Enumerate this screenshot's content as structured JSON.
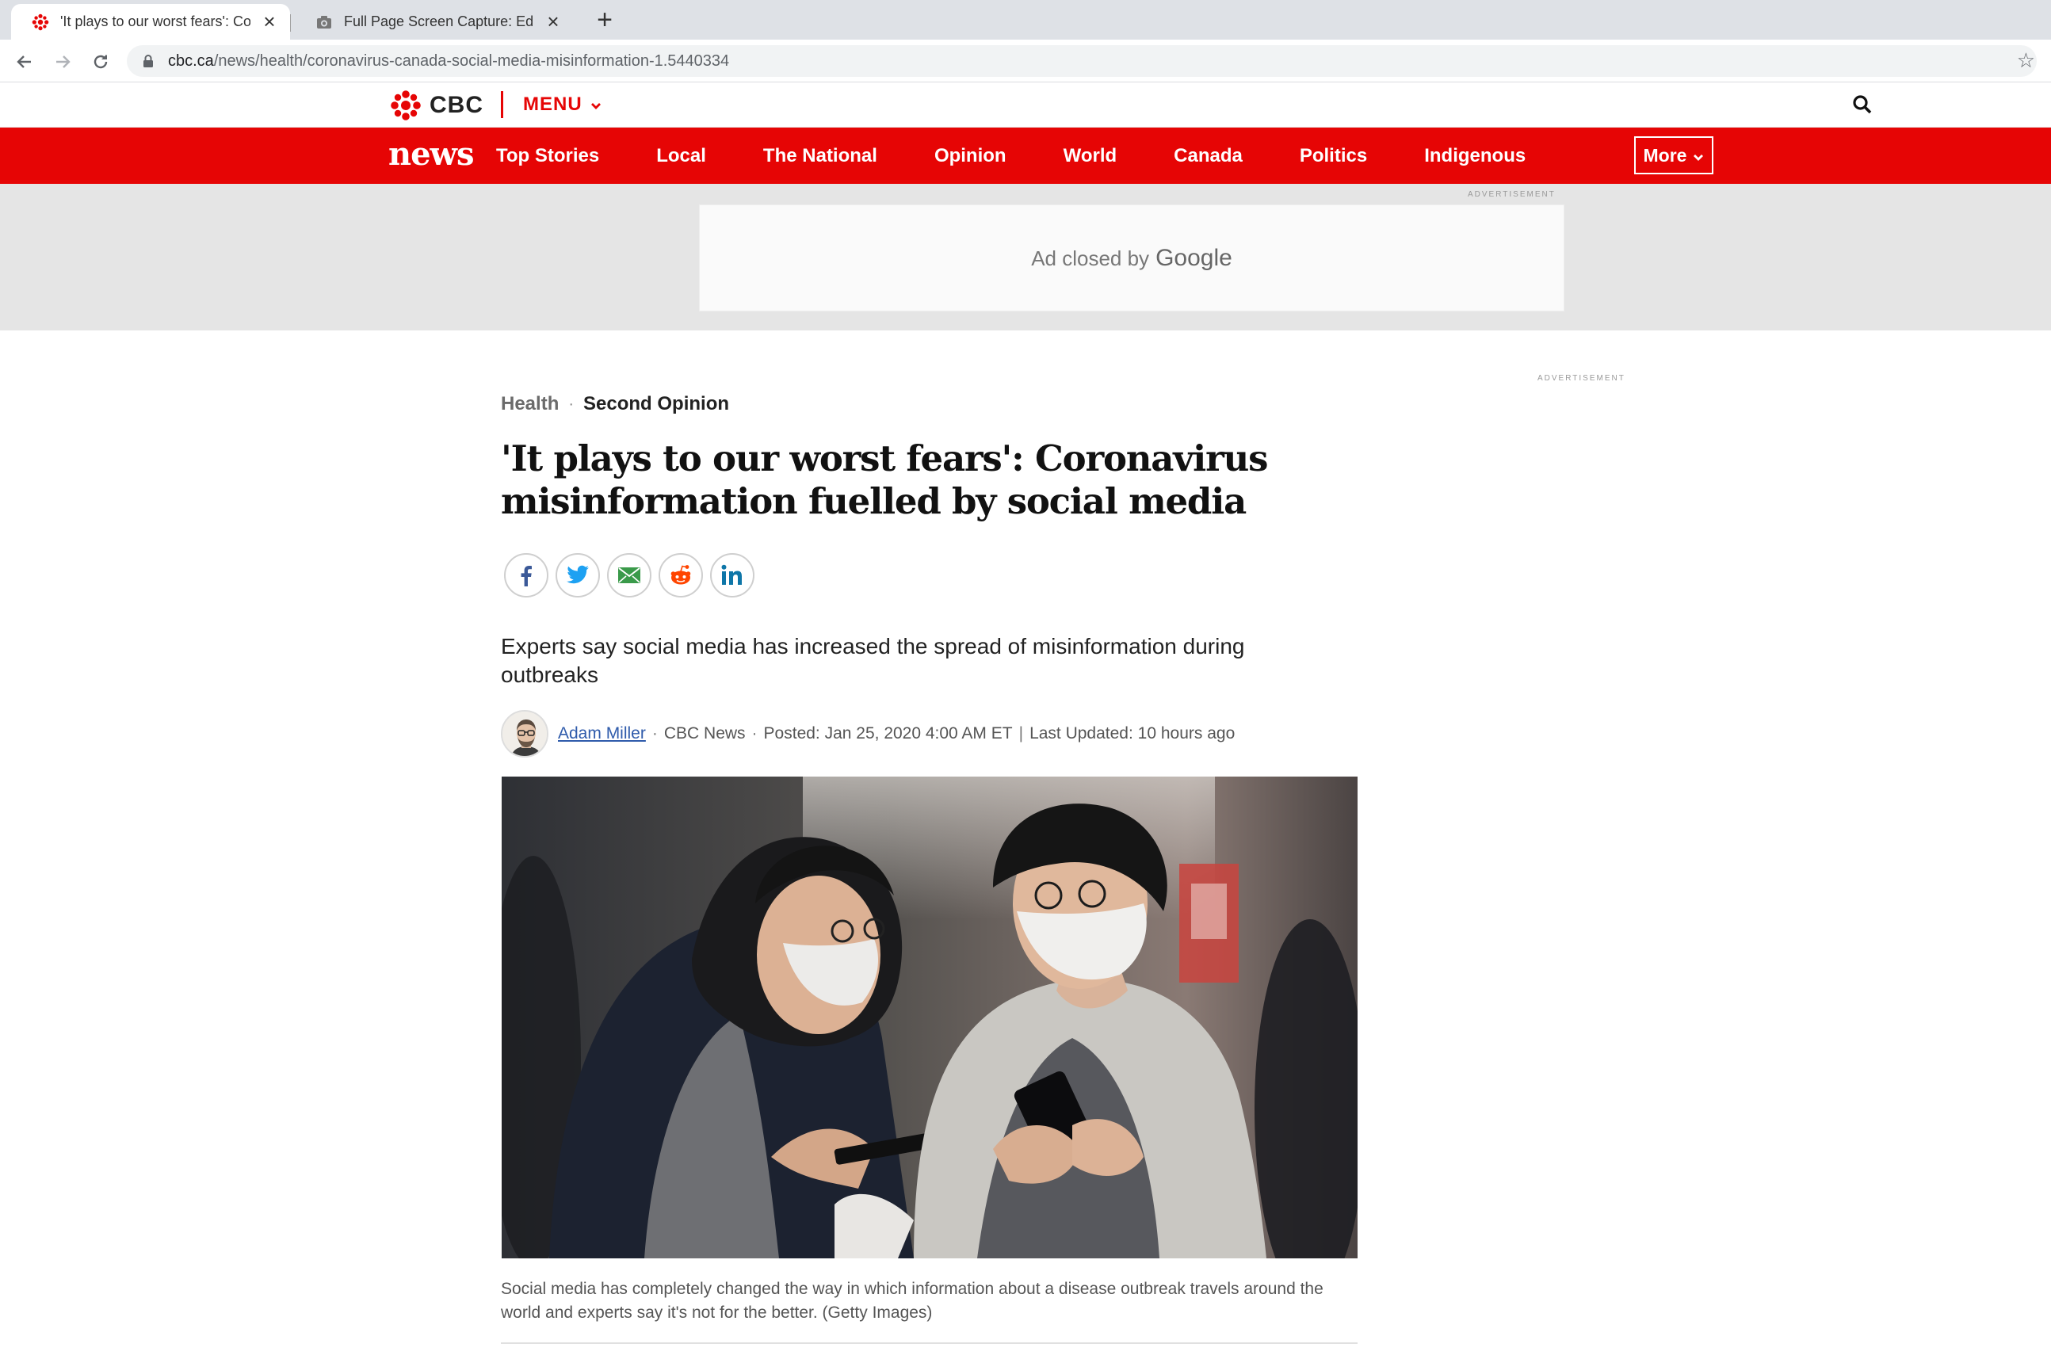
{
  "browser": {
    "tabs": [
      {
        "title": "'It plays to our worst fears': Coronavirus misinfo",
        "icon": "cbc-gem-icon",
        "active": true
      },
      {
        "title": "Full Page Screen Capture: Editor",
        "icon": "camera-icon",
        "active": false
      }
    ],
    "url_domain": "cbc.ca",
    "url_path": "/news/health/coronavirus-canada-social-media-misinformation-1.5440334"
  },
  "header": {
    "brand": "CBC",
    "menu_label": "MENU"
  },
  "newsnav": {
    "logo": "news",
    "items": [
      "Top Stories",
      "Local",
      "The National",
      "Opinion",
      "World",
      "Canada",
      "Politics",
      "Indigenous"
    ],
    "more_label": "More"
  },
  "ad": {
    "label": "ADVERTISEMENT",
    "closed_text": "Ad closed by",
    "closed_brand": "Google",
    "side_label": "ADVERTISEMENT"
  },
  "article": {
    "section": "Health",
    "subsection": "Second Opinion",
    "headline": "'It plays to our worst fears': Coronavirus misinformation fuelled by social media",
    "share_icons": [
      "facebook-icon",
      "twitter-icon",
      "email-icon",
      "reddit-icon",
      "linkedin-icon"
    ],
    "deck": "Experts say social media has increased the spread of misinformation during outbreaks",
    "author": "Adam Miller",
    "source": "CBC News",
    "posted": "Posted: Jan 25, 2020 4:00 AM ET",
    "updated": "Last Updated: 10 hours ago",
    "caption": "Social media has completely changed the way in which information about a disease outbreak travels around the world and experts say it's not for the better. (Getty Images)"
  },
  "colors": {
    "cbc_red": "#e60505",
    "link_blue": "#2f5bab",
    "ad_band": "#e5e5e5"
  }
}
